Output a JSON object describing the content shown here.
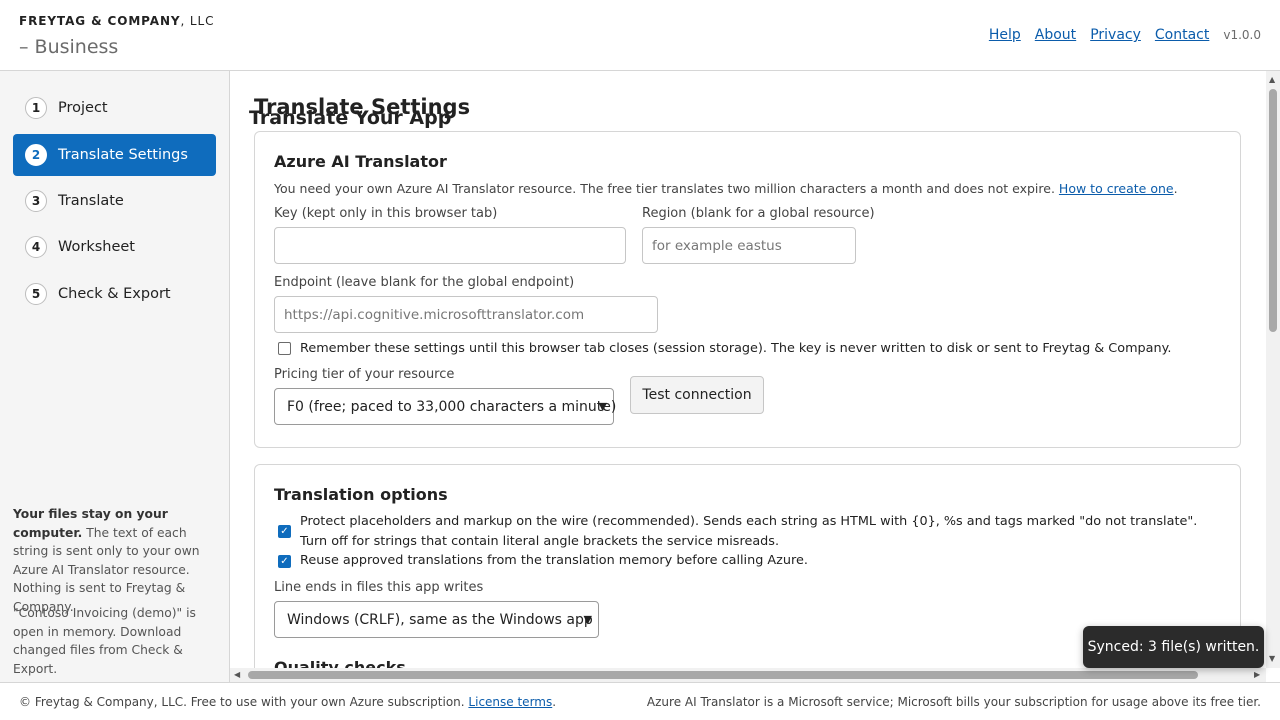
{
  "header": {
    "company_name": "FREYTAG & COMPANY",
    "company_suffix": ", LLC",
    "app_title": "Translate Your App",
    "title_separator": " – ",
    "edition": "Business",
    "nav": [
      "Help",
      "About",
      "Privacy",
      "Contact"
    ],
    "version": "v1.0.0"
  },
  "sidebar": {
    "steps": [
      {
        "num": "1",
        "label": "Project"
      },
      {
        "num": "2",
        "label": "Translate Settings"
      },
      {
        "num": "3",
        "label": "Translate"
      },
      {
        "num": "4",
        "label": "Worksheet"
      },
      {
        "num": "5",
        "label": "Check & Export"
      }
    ],
    "active_step": "2",
    "note_heading": "Your files stay on your computer.",
    "note_body": "The text of each string is sent only to your own Azure AI Translator resource. Nothing is sent to Freytag & Company.",
    "project_note": "\"Contoso Invoicing (demo)\" is open in memory. Download changed files from Check & Export."
  },
  "main": {
    "title": "Translate Settings",
    "azure": {
      "heading": "Azure AI Translator",
      "hint": "You need your own Azure AI Translator resource. The free tier translates two million characters a month and does not expire.",
      "hint_link": "How to create one",
      "hint_end": ".",
      "key_label": "Key (kept only in this browser tab)",
      "key_value": "",
      "region_label": "Region (blank for a global resource)",
      "region_placeholder": "for example eastus",
      "endpoint_label": "Endpoint (leave blank for the global endpoint)",
      "endpoint_placeholder": "https://api.cognitive.microsofttranslator.com",
      "remember_label": "Remember these settings until this browser tab closes (session storage). The key is never written to disk or sent to Freytag & Company.",
      "remember_checked": false,
      "tier_label": "Pricing tier of your resource",
      "tier_value": "F0 (free; paced to 33,000 characters a minute)",
      "test_button": "Test connection"
    },
    "options": {
      "heading": "Translation options",
      "protect_label": "Protect placeholders and markup on the wire (recommended). Sends each string as HTML with {0}, %s and tags marked \"do not translate\". Turn off for strings that contain literal angle brackets the service misreads.",
      "protect_checked": true,
      "reuse_label": "Reuse approved translations from the translation memory before calling Azure.",
      "reuse_checked": true,
      "line_ends_label": "Line ends in files this app writes",
      "line_ends_value": "Windows (CRLF), same as the Windows app"
    },
    "quality_heading": "Quality checks"
  },
  "footer": {
    "left": "© Freytag & Company, LLC. Free to use with your own Azure subscription.",
    "license_link": "License terms",
    "left_end": ".",
    "right": "Azure AI Translator is a Microsoft service; Microsoft bills your subscription for usage above its free tier."
  },
  "toast": "Synced: 3 file(s) written."
}
